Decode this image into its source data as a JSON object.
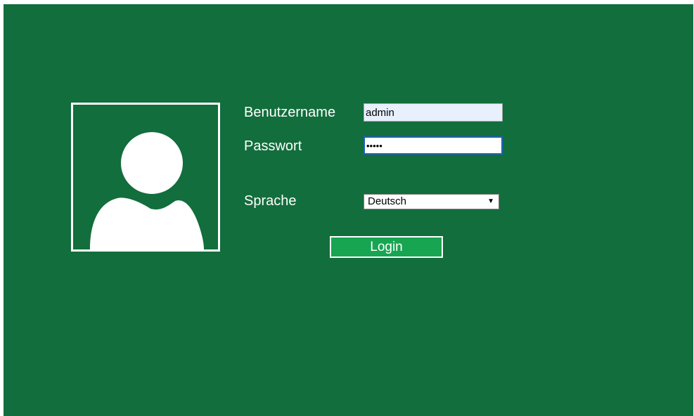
{
  "login": {
    "username_label": "Benutzername",
    "username_value": "admin",
    "password_label": "Passwort",
    "password_value": "admin",
    "language_label": "Sprache",
    "language_selected": "Deutsch",
    "login_button_label": "Login"
  },
  "icons": {
    "avatar": "user-silhouette-icon",
    "dropdown": "caret-down-icon"
  },
  "colors": {
    "background": "#126e3c",
    "button": "#17a552",
    "text": "#ffffff",
    "autofill_input": "#e8f0fe",
    "focus_border": "#1f5fc5"
  }
}
